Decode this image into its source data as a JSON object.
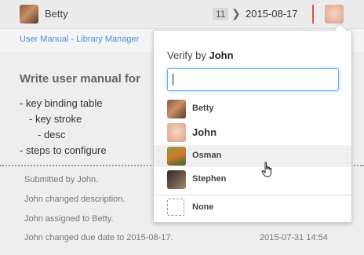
{
  "header": {
    "assignee_name": "Betty",
    "count_badge": "11",
    "due_date": "2015-08-17"
  },
  "breadcrumb": "User Manual - Library Manager",
  "task": {
    "title": "Write user manual for",
    "description": [
      "- key binding table",
      "- key stroke",
      "- desc",
      "- steps to configure"
    ]
  },
  "activity": [
    "Submitted by John.",
    "John changed description.",
    "John assigned to Betty.",
    "John changed due date to 2015-08-17."
  ],
  "activity_last_time": "2015-07-31 14:54",
  "verify_popup": {
    "heading_prefix": "Verify by",
    "heading_user": "John",
    "search_value": "",
    "options": [
      {
        "label": "Betty",
        "avatar": "betty-avatar"
      },
      {
        "label": "John",
        "avatar": "john-avatar"
      },
      {
        "label": "Osman",
        "avatar": "osman-avatar"
      },
      {
        "label": "Stephen",
        "avatar": "stephen-avatar"
      }
    ],
    "none_label": "None"
  },
  "colors": {
    "accent_blue": "#4a8fd4",
    "due_bar_red": "#d9534f",
    "hover_row": "#f0f0f0"
  }
}
